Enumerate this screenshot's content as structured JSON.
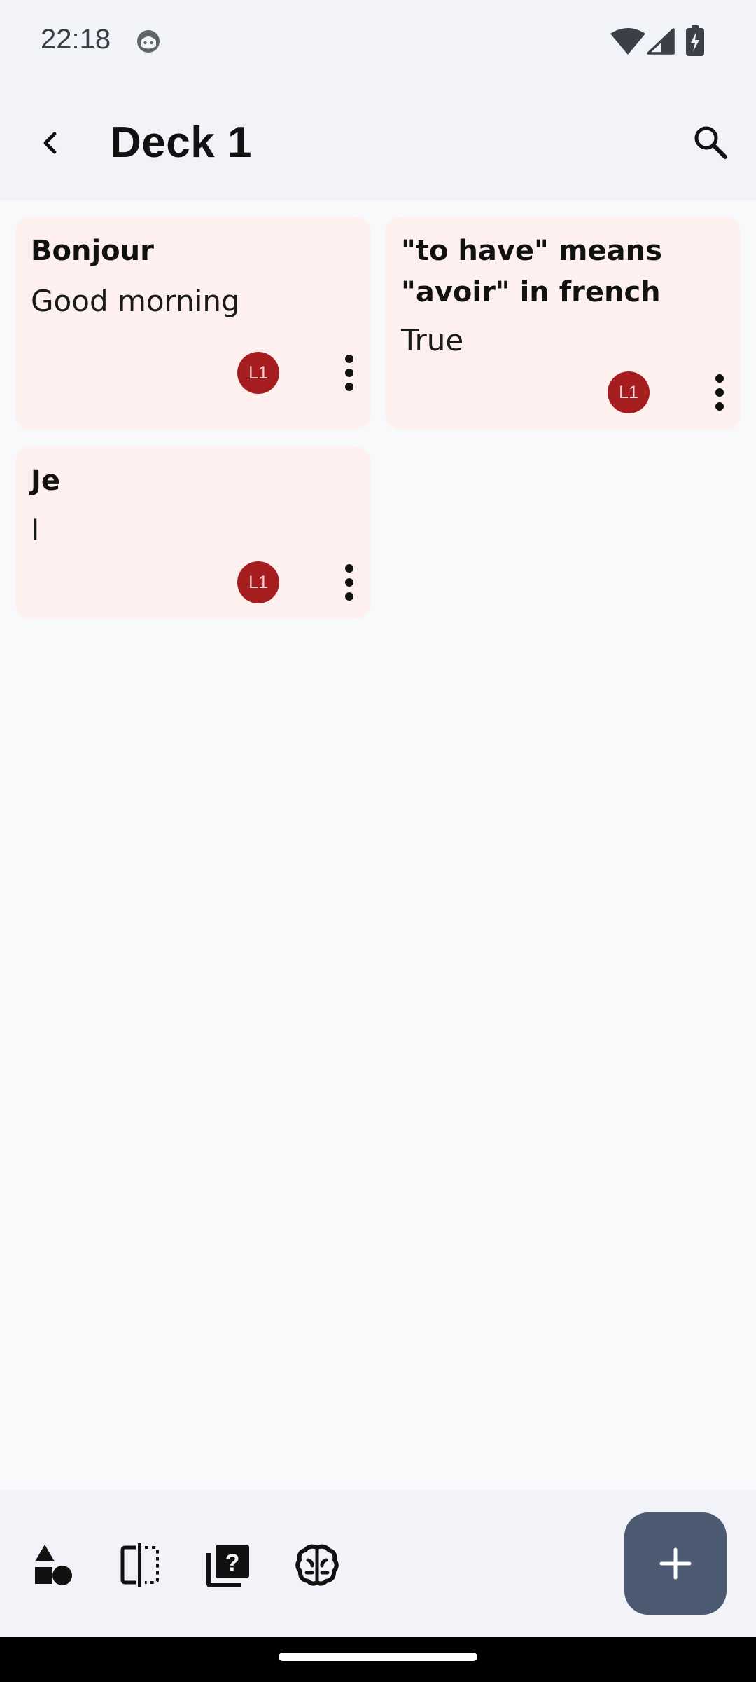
{
  "status_bar": {
    "time": "22:18"
  },
  "header": {
    "title": "Deck 1",
    "back_icon": "arrow-back-icon",
    "search_icon": "search-icon"
  },
  "cards": [
    {
      "front": "Bonjour",
      "back": "Good morning",
      "level": "L1"
    },
    {
      "front": "\"to have\" means \"avoir\" in french",
      "back": "True",
      "level": "L1"
    },
    {
      "front": "Je",
      "back": "I",
      "level": "L1"
    }
  ],
  "bottom_bar": {
    "actions": [
      "shapes-icon",
      "compare-icon",
      "quiz-icon",
      "brain-icon"
    ],
    "fab_icon": "add-icon"
  },
  "colors": {
    "card_background": "#fff0f0",
    "level_badge": "#a61d1f",
    "fab": "#4b5a70",
    "bar_background": "#f1f3f8"
  }
}
